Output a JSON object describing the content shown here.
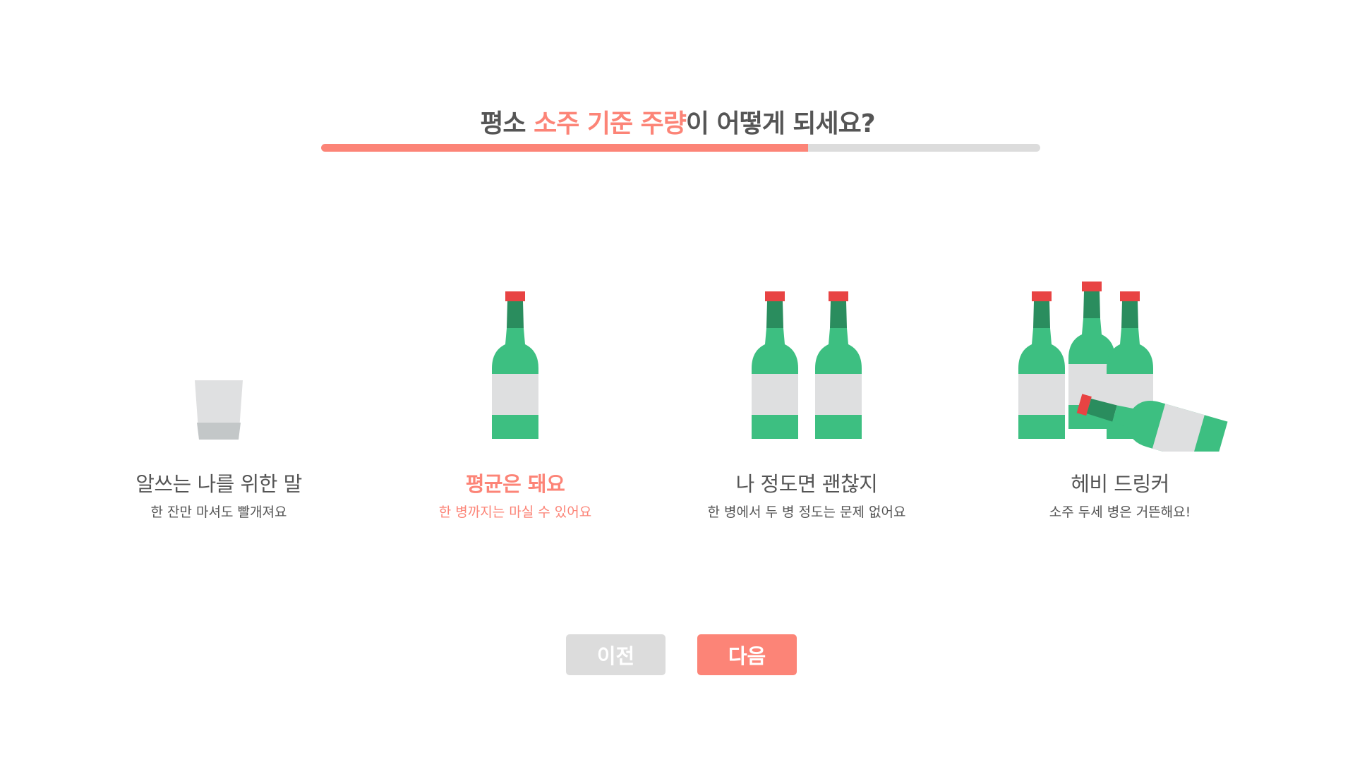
{
  "question": {
    "prefix": "평소 ",
    "highlight": "소주 기준 주량",
    "suffix": "이 어떻게 되세요?"
  },
  "progress": {
    "fraction": 0.677
  },
  "options": [
    {
      "title": "알쓰는 나를 위한 말",
      "desc": "한 잔만 마셔도 빨개져요",
      "icon": "soju-glass-icon",
      "selected": false
    },
    {
      "title": "평균은 돼요",
      "desc": "한 병까지는 마실 수 있어요",
      "icon": "one-bottle-icon",
      "selected": true
    },
    {
      "title": "나 정도면 괜찮지",
      "desc": "한 병에서 두 병 정도는 문제 없어요",
      "icon": "two-bottles-icon",
      "selected": false
    },
    {
      "title": "헤비 드링커",
      "desc": "소주 두세 병은 거뜬해요!",
      "icon": "many-bottles-icon",
      "selected": false
    }
  ],
  "buttons": {
    "prev_label": "이전",
    "next_label": "다음"
  },
  "colors": {
    "accent": "#fc8477",
    "text": "#555555",
    "track": "#dcdcdc",
    "bottle_green": "#3dbf81",
    "bottle_neck": "#2a8d5e",
    "cap_red": "#e84343",
    "label_gray": "#dedfe0"
  }
}
